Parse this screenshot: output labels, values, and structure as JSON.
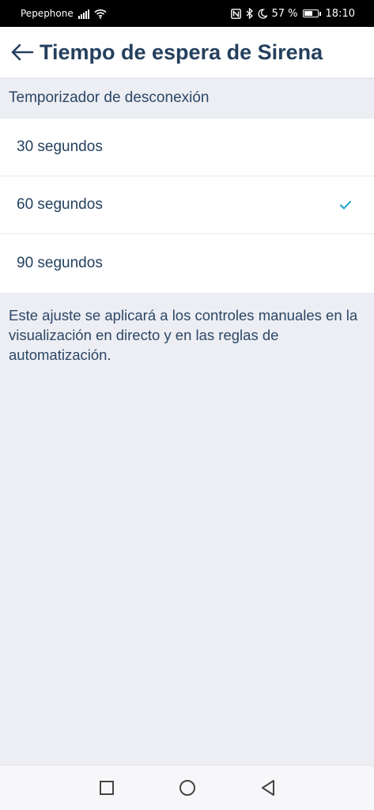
{
  "status_bar": {
    "carrier": "Pepephone",
    "battery_percent": "57 %",
    "battery_level": 0.57,
    "time": "18:10",
    "icons": [
      "signal-icon",
      "wifi-icon",
      "nfc-icon",
      "bluetooth-icon",
      "moon-icon",
      "battery-icon"
    ]
  },
  "header": {
    "back_icon": "arrow-left-icon",
    "title": "Tiempo de espera de Sirena"
  },
  "section": {
    "label": "Temporizador de desconexión"
  },
  "options": [
    {
      "label": "30 segundos",
      "selected": false
    },
    {
      "label": "60 segundos",
      "selected": true
    },
    {
      "label": "90 segundos",
      "selected": false
    }
  ],
  "note": "Este ajuste se aplicará a los controles manuales en la visualización en directo y en las reglas de automatización.",
  "nav_bar": {
    "icons": [
      "square-recents-icon",
      "circle-home-icon",
      "triangle-back-icon"
    ]
  },
  "colors": {
    "accent_check": "#1aa3c9",
    "title": "#24405e",
    "background": "#eceef3"
  }
}
